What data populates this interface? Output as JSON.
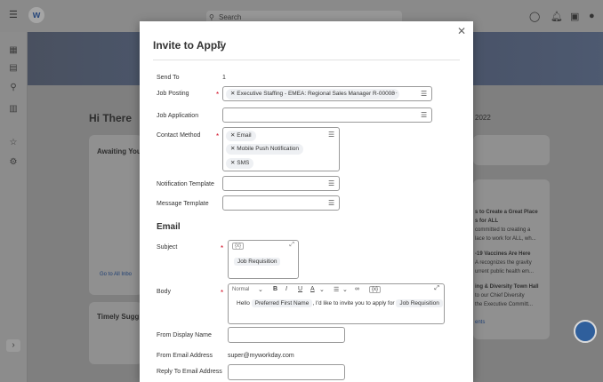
{
  "background": {
    "hero_greeting": "Hi There",
    "awaiting_label": "Awaiting You",
    "timely_label": "Timely Sugg",
    "go_to_link": "Go to All Inbo",
    "year_text": "2022",
    "news": [
      "s to Create a Great Place",
      "s for ALL",
      "committed to creating a",
      "lace to work for ALL, wh...",
      "-19 Vaccines Are Here",
      "A recognizes the gravity",
      "urrent public health em...",
      "ing & Diversity Town Hall",
      "to our Chief Diversity",
      "the Executive Committ...",
      "ents"
    ],
    "search_placeholder": "Search"
  },
  "modal": {
    "title": "Invite to Apply",
    "fields": {
      "send_to_label": "Send To",
      "send_to_value": "1",
      "job_posting_label": "Job Posting",
      "job_posting_value": "Executive Staffing - EMEA: Regional Sales Manager R-00008",
      "job_application_label": "Job Application",
      "contact_method_label": "Contact Method",
      "contact_methods": [
        "Email",
        "Mobile Push Notification",
        "SMS"
      ],
      "notification_template_label": "Notification Template",
      "message_template_label": "Message Template"
    },
    "email": {
      "section_title": "Email",
      "subject_label": "Subject",
      "subject_token": "Job Requisition",
      "body_label": "Body",
      "toolbar_style": "Normal",
      "body_prefix": "Hello",
      "body_token_name": "Preferred First Name",
      "body_middle": ", I'd like to invite you to apply for",
      "body_token_job": "Job Requisition",
      "from_display_label": "From Display Name",
      "from_email_label": "From Email Address",
      "from_email_value": "super@myworkday.com",
      "reply_to_label": "Reply To Email Address"
    }
  }
}
